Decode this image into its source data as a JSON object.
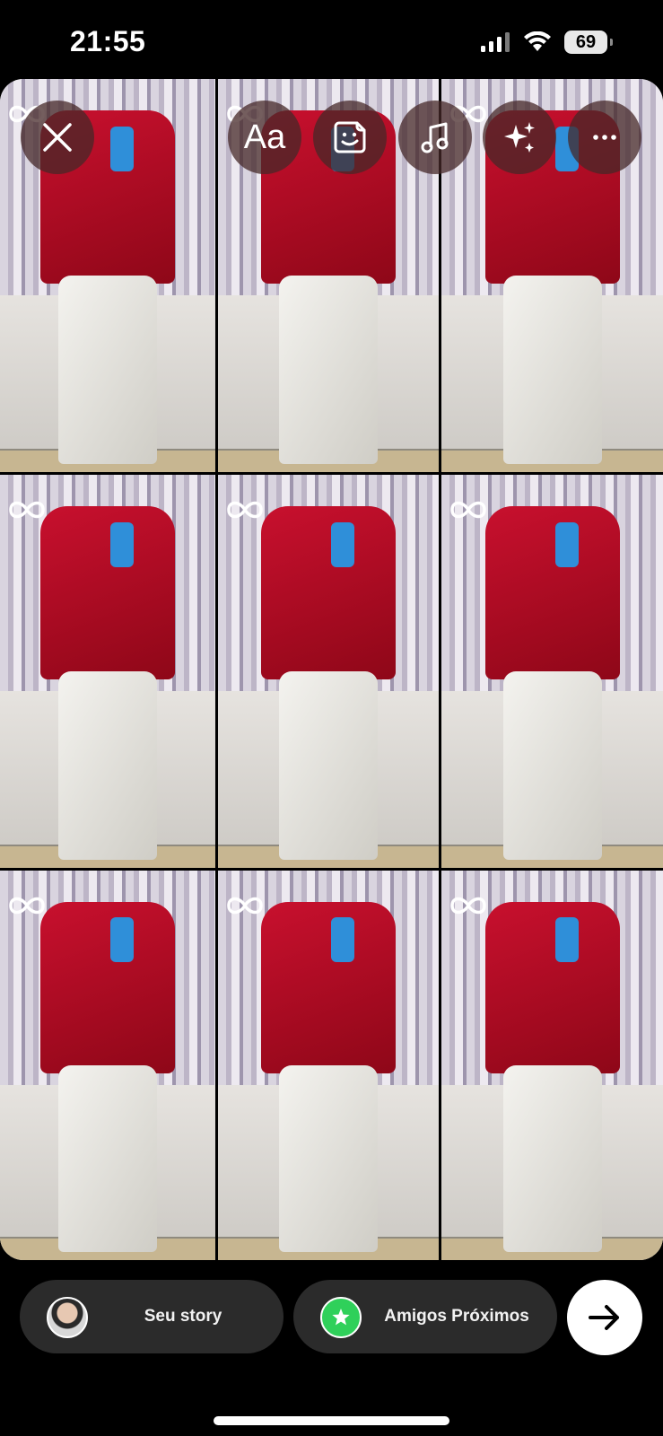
{
  "status_bar": {
    "time": "21:55",
    "battery": "69"
  },
  "tools": {
    "close_icon": "close-icon",
    "text_label": "Aa",
    "sticker_icon": "sticker-icon",
    "music_icon": "music-icon",
    "effects_icon": "sparkles-icon",
    "more_icon": "more-icon"
  },
  "collage": {
    "cells": 9,
    "loop_icon": "infinity-loop-icon"
  },
  "share": {
    "your_story_label": "Seu story",
    "close_friends_label": "Amigos Próximos",
    "send_icon": "arrow-right-icon"
  },
  "colors": {
    "close_friends_green": "#2fd05a",
    "pill_bg": "#2b2b2b",
    "tool_bg": "#46282899"
  }
}
